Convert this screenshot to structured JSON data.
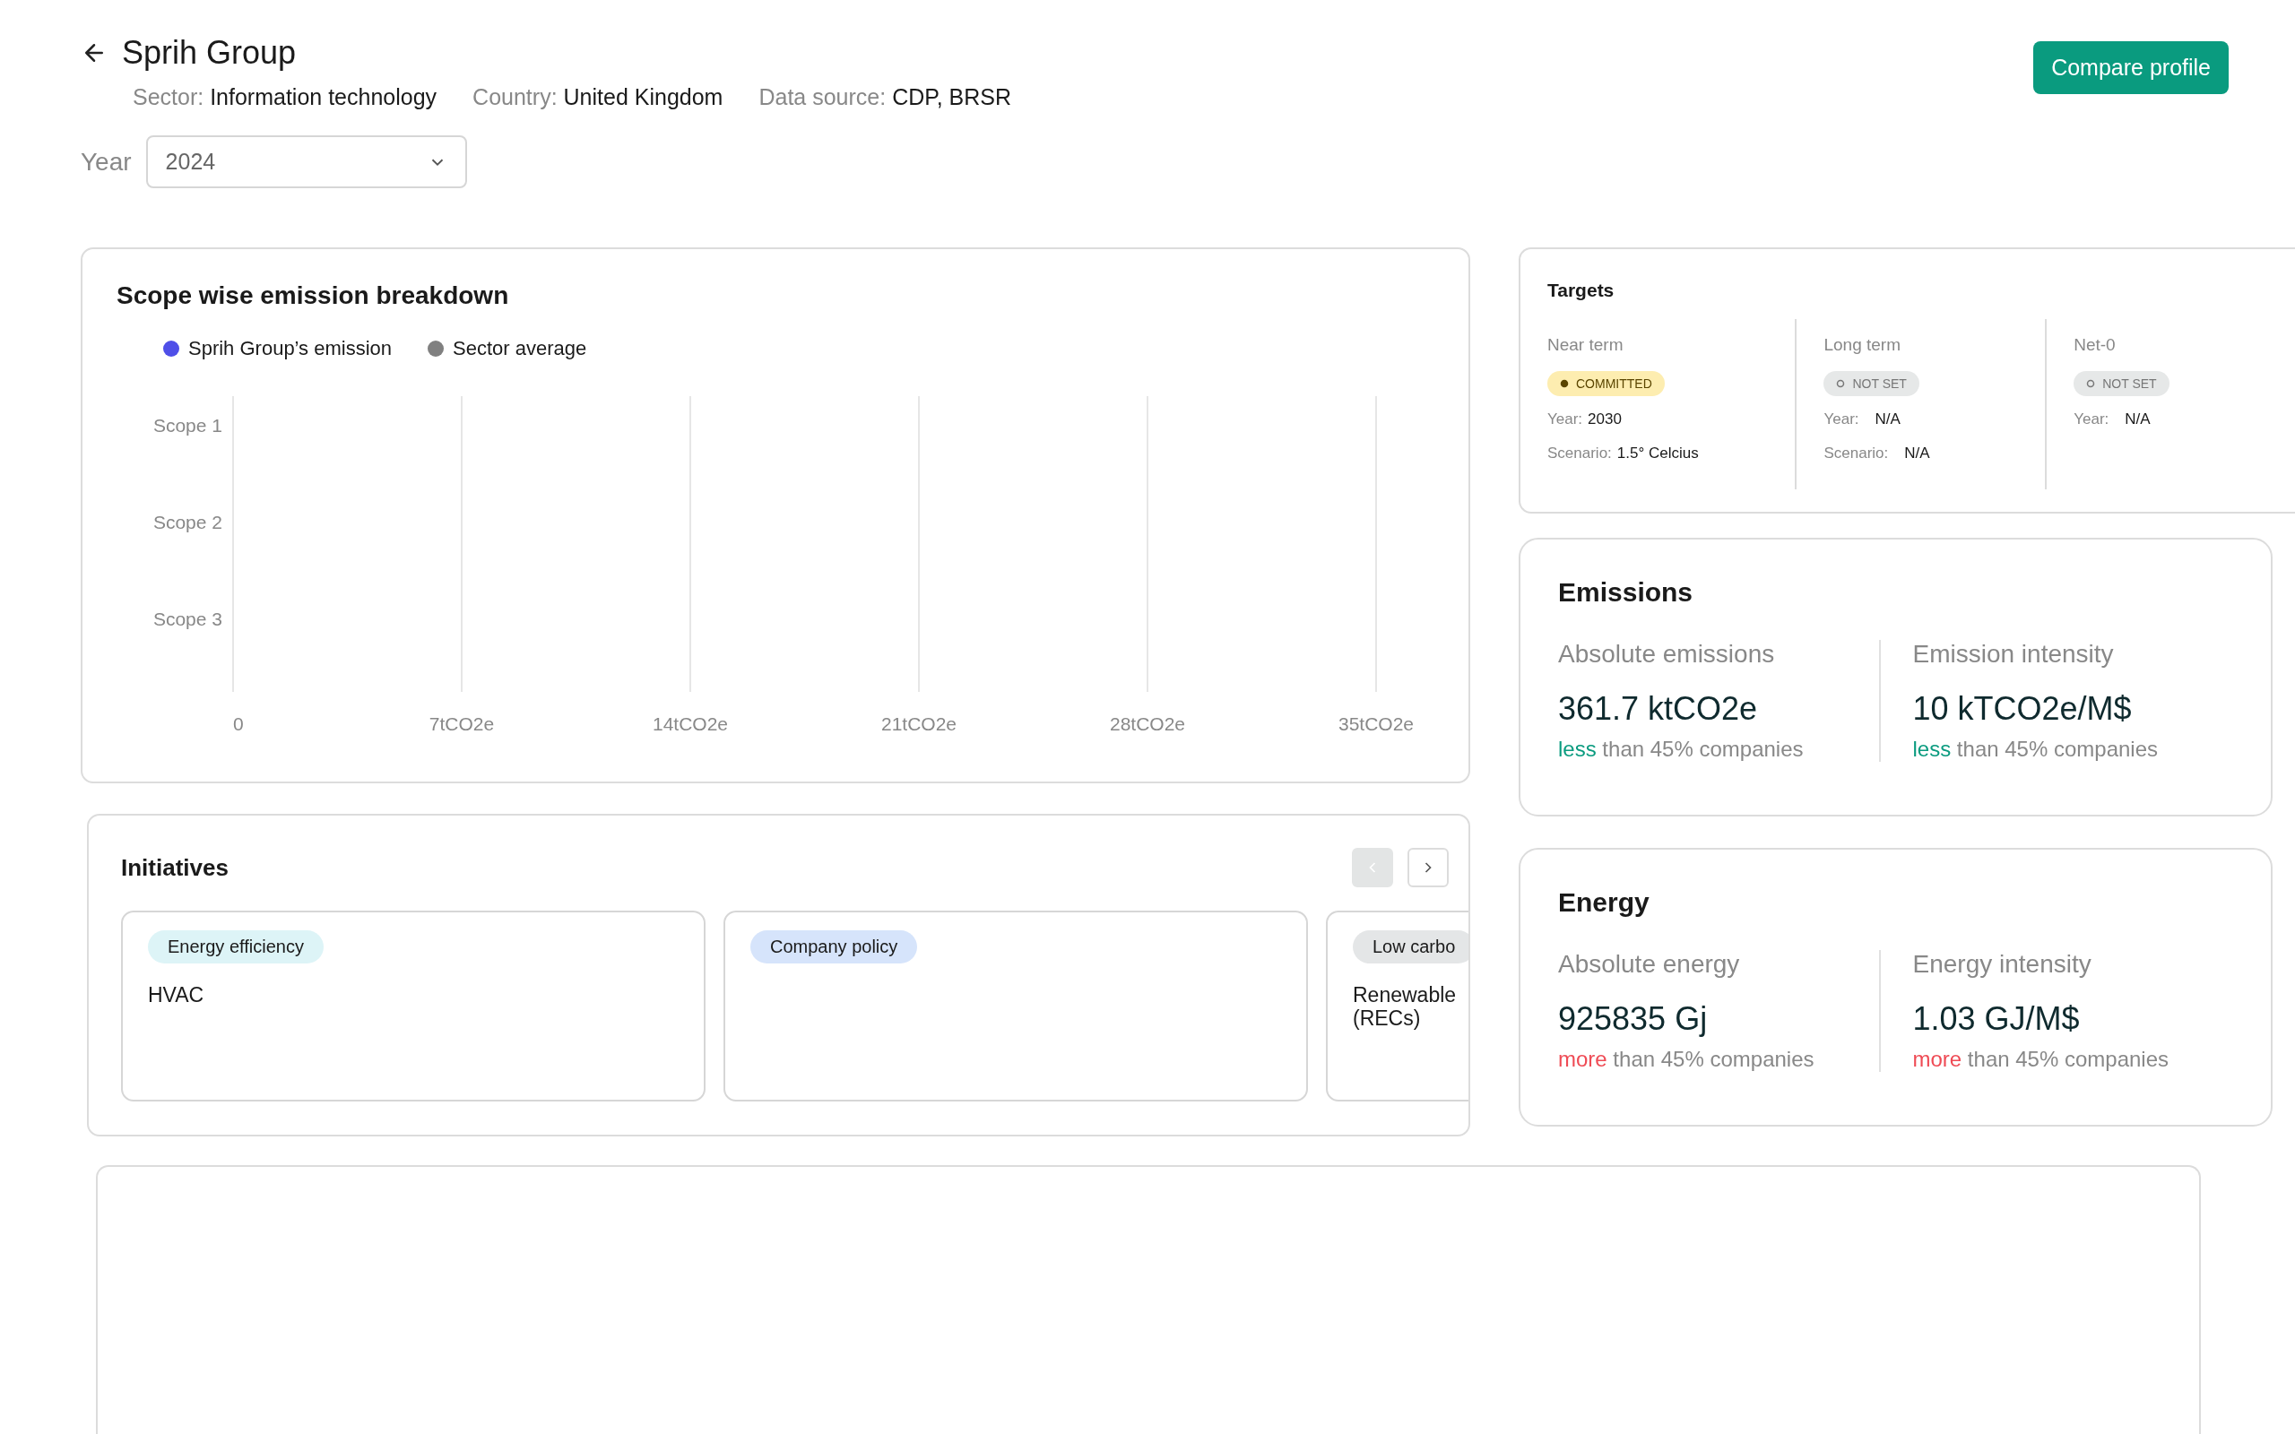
{
  "header": {
    "title": "Sprih Group",
    "meta": [
      {
        "label": "Sector:",
        "value": "Information technology"
      },
      {
        "label": "Country:",
        "value": "United Kingdom"
      },
      {
        "label": "Data source:",
        "value": "CDP, BRSR"
      }
    ],
    "action": "Compare profile"
  },
  "year": {
    "label": "Year",
    "value": "2024"
  },
  "emission_breakdown": {
    "title": "Scope wise emission breakdown",
    "legend": [
      {
        "name": "Sprih Group’s emission",
        "color": "#4f4fe8"
      },
      {
        "name": "Sector average",
        "color": "#808080"
      }
    ],
    "row_labels": [
      "Scope 1",
      "Scope 2",
      "Scope 3"
    ],
    "axis_labels": [
      "0",
      "7tCO2e",
      "14tCO2e",
      "21tCO2e",
      "28tCO2e",
      "35tCO2e"
    ]
  },
  "initiatives": {
    "title": "Initiatives",
    "prev_disabled": true,
    "next_disabled": false,
    "items": [
      {
        "tag": "Energy efficiency",
        "color": "#ddf4f7",
        "description": "HVAC"
      },
      {
        "tag": "Company policy",
        "color": "#d6e4fb"
      },
      {
        "tag": "Low carbo",
        "color": "#e4e6e7",
        "description": "Renewable (RECs)"
      }
    ]
  },
  "targets": {
    "title": "Targets",
    "columns": [
      {
        "label": "Near term",
        "status": {
          "text": "COMMITTED",
          "kind": "committed"
        },
        "fields": [
          {
            "label": "Year:",
            "value": "2030"
          },
          {
            "label": "Scenario:",
            "value": "1.5° Celcius"
          }
        ]
      },
      {
        "label": "Long term",
        "status": {
          "text": "NOT SET",
          "kind": "not_set"
        },
        "fields": [
          {
            "label": "Year:",
            "value": "N/A"
          },
          {
            "label": "Scenario:",
            "value": "N/A"
          }
        ]
      },
      {
        "label": "Net-0",
        "status": {
          "text": "NOT SET",
          "kind": "not_set"
        },
        "fields": [
          {
            "label": "Year:",
            "value": "N/A"
          }
        ]
      }
    ]
  },
  "metric_cards": [
    {
      "title": "Emissions",
      "metrics": [
        {
          "label": "Absolute emissions",
          "value": "361.7 ktCO2e",
          "comparison": {
            "word": "less",
            "kind": "lower",
            "rest": "than 45% companies"
          }
        },
        {
          "label": "Emission intensity",
          "value": "10 kTCO2e/M$",
          "comparison": {
            "word": "less",
            "kind": "lower",
            "rest": "than 45% companies"
          }
        }
      ]
    },
    {
      "title": "Energy",
      "metrics": [
        {
          "label": "Absolute energy",
          "value": "925835 Gj",
          "comparison": {
            "word": "more",
            "kind": "higher",
            "rest": "than 45% companies"
          }
        },
        {
          "label": "Energy intensity",
          "value": "1.03 GJ/M$",
          "comparison": {
            "word": "more",
            "kind": "higher",
            "rest": "than 45% companies"
          }
        }
      ]
    }
  ]
}
